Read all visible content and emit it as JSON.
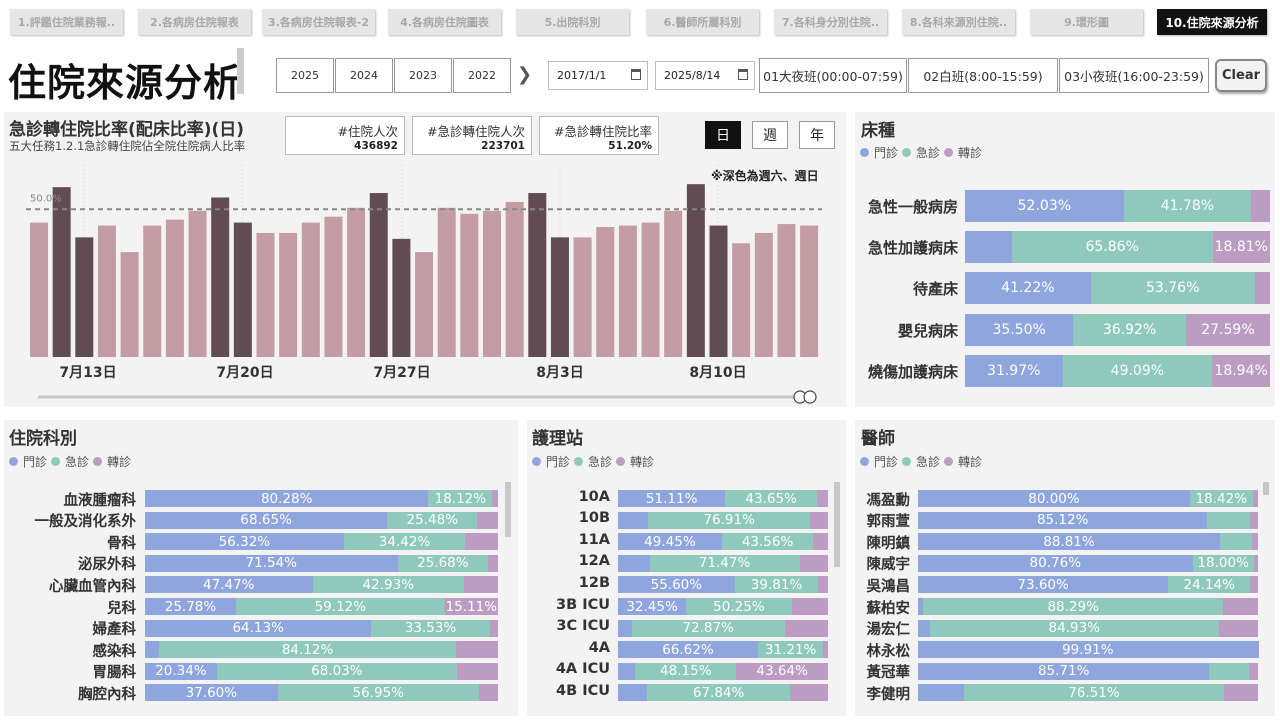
{
  "tabs": [
    {
      "label": "1.評鑑住院業務報.."
    },
    {
      "label": "2.各病房住院報表"
    },
    {
      "label": "3.各病房住院報表-2"
    },
    {
      "label": "4.各病房住院圖表"
    },
    {
      "label": "5.出院科別"
    },
    {
      "label": "6.醫師所屬科別"
    },
    {
      "label": "7.各科身分別住院.."
    },
    {
      "label": "8.各科來源別住院.."
    },
    {
      "label": "9.環形圖"
    },
    {
      "label": "10.住院來源分析"
    }
  ],
  "page_title": "住院來源分析",
  "years": [
    "2025",
    "2024",
    "2023",
    "2022"
  ],
  "date_from": "2017/1/1",
  "date_to": "2025/8/14",
  "shifts": [
    "01大夜班(00:00-07:59)",
    "02白班(8:00-15:59)",
    "03小夜班(16:00-23:59)"
  ],
  "clear_label": "Clear",
  "legend": {
    "outpatient": "門診",
    "emergency": "急診",
    "transfer": "轉診"
  },
  "colors": {
    "outpatient": "#8ea6dd",
    "emergency": "#8fc9bb",
    "transfer": "#bd9cc3",
    "bar_weekday": "#c49ca3",
    "bar_weekend": "#604c52"
  },
  "rate_panel": {
    "title": "急診轉住院比率(配床比率)(日)",
    "subtitle": "五大任務1.2.1急診轉住院佔全院住院病人比率",
    "kpis": [
      {
        "label": "#住院人次",
        "value": "436892"
      },
      {
        "label": "#急診轉住院人次",
        "value": "223701"
      },
      {
        "label": "#急診轉住院比率",
        "value": "51.20%"
      }
    ],
    "granularity": [
      "日",
      "週",
      "年"
    ],
    "note": "※深色為週六、週日",
    "ref_label": "50.0%"
  },
  "chart_data": {
    "type": "bar",
    "title": "急診轉住院比率(配床比率)(日)",
    "x_tick_labels": [
      "7月13日",
      "7月20日",
      "7月27日",
      "8月3日",
      "8月10日"
    ],
    "values": [
      45.5,
      57.5,
      40.5,
      44.5,
      35.5,
      44.5,
      46.5,
      49.5,
      54.0,
      45.5,
      42.0,
      42.0,
      45.5,
      47.5,
      50.5,
      55.5,
      40.0,
      35.5,
      50.5,
      48.5,
      49.5,
      52.5,
      55.5,
      40.5,
      40.5,
      44.0,
      44.5,
      45.5,
      49.5,
      58.5,
      44.5,
      38.5,
      42.0,
      45.0,
      44.5
    ],
    "weekend": [
      false,
      true,
      true,
      false,
      false,
      false,
      false,
      false,
      true,
      true,
      false,
      false,
      false,
      false,
      false,
      true,
      true,
      false,
      false,
      false,
      false,
      false,
      true,
      true,
      false,
      false,
      false,
      false,
      false,
      true,
      true,
      false,
      false,
      false,
      false
    ],
    "ref_line": 50.0,
    "ylim": [
      0,
      65
    ]
  },
  "bed_panel": {
    "title": "床種",
    "rows": [
      {
        "name": "急性一般病房",
        "o": 52.03,
        "e": 41.78,
        "t": 6.19,
        "lo": "52.03%",
        "le": "41.78%",
        "lt": ""
      },
      {
        "name": "急性加護病床",
        "o": 15.33,
        "e": 65.86,
        "t": 18.81,
        "lo": "",
        "le": "65.86%",
        "lt": "18.81%"
      },
      {
        "name": "待產床",
        "o": 41.22,
        "e": 53.76,
        "t": 5.02,
        "lo": "41.22%",
        "le": "53.76%",
        "lt": ""
      },
      {
        "name": "嬰兒病床",
        "o": 35.5,
        "e": 36.92,
        "t": 27.59,
        "lo": "35.50%",
        "le": "36.92%",
        "lt": "27.59%"
      },
      {
        "name": "燒傷加護病床",
        "o": 31.97,
        "e": 49.09,
        "t": 18.94,
        "lo": "31.97%",
        "le": "49.09%",
        "lt": "18.94%"
      }
    ]
  },
  "dept_panel": {
    "title": "住院科別",
    "rows": [
      {
        "name": "血液腫瘤科",
        "o": 80.28,
        "e": 18.12,
        "t": 1.6,
        "lo": "80.28%",
        "le": "18.12%",
        "lt": ""
      },
      {
        "name": "一般及消化系外",
        "o": 68.65,
        "e": 25.48,
        "t": 5.87,
        "lo": "68.65%",
        "le": "25.48%",
        "lt": ""
      },
      {
        "name": "骨科",
        "o": 56.32,
        "e": 34.42,
        "t": 9.26,
        "lo": "56.32%",
        "le": "34.42%",
        "lt": ""
      },
      {
        "name": "泌尿外科",
        "o": 71.54,
        "e": 25.68,
        "t": 2.78,
        "lo": "71.54%",
        "le": "25.68%",
        "lt": ""
      },
      {
        "name": "心臟血管內科",
        "o": 47.47,
        "e": 42.93,
        "t": 9.6,
        "lo": "47.47%",
        "le": "42.93%",
        "lt": ""
      },
      {
        "name": "兒科",
        "o": 25.78,
        "e": 59.12,
        "t": 15.11,
        "lo": "25.78%",
        "le": "59.12%",
        "lt": "15.11%"
      },
      {
        "name": "婦產科",
        "o": 64.13,
        "e": 33.53,
        "t": 2.34,
        "lo": "64.13%",
        "le": "33.53%",
        "lt": ""
      },
      {
        "name": "感染科",
        "o": 4.0,
        "e": 84.12,
        "t": 11.88,
        "lo": "",
        "le": "84.12%",
        "lt": ""
      },
      {
        "name": "胃腸科",
        "o": 20.34,
        "e": 68.03,
        "t": 11.63,
        "lo": "20.34%",
        "le": "68.03%",
        "lt": ""
      },
      {
        "name": "胸腔內科",
        "o": 37.6,
        "e": 56.95,
        "t": 5.45,
        "lo": "37.60%",
        "le": "56.95%",
        "lt": ""
      }
    ]
  },
  "station_panel": {
    "title": "護理站",
    "rows": [
      {
        "name": "10A",
        "o": 51.11,
        "e": 43.65,
        "t": 5.24,
        "lo": "51.11%",
        "le": "43.65%",
        "lt": ""
      },
      {
        "name": "10B",
        "o": 14.5,
        "e": 76.91,
        "t": 8.59,
        "lo": "",
        "le": "76.91%",
        "lt": ""
      },
      {
        "name": "11A",
        "o": 49.45,
        "e": 43.56,
        "t": 6.99,
        "lo": "49.45%",
        "le": "43.56%",
        "lt": ""
      },
      {
        "name": "12A",
        "o": 15.0,
        "e": 71.47,
        "t": 13.53,
        "lo": "",
        "le": "71.47%",
        "lt": ""
      },
      {
        "name": "12B",
        "o": 55.6,
        "e": 39.81,
        "t": 4.59,
        "lo": "55.60%",
        "le": "39.81%",
        "lt": ""
      },
      {
        "name": "3B ICU",
        "o": 32.45,
        "e": 50.25,
        "t": 17.3,
        "lo": "32.45%",
        "le": "50.25%",
        "lt": ""
      },
      {
        "name": "3C ICU",
        "o": 6.5,
        "e": 72.87,
        "t": 20.63,
        "lo": "",
        "le": "72.87%",
        "lt": ""
      },
      {
        "name": "4A",
        "o": 66.62,
        "e": 31.21,
        "t": 2.17,
        "lo": "66.62%",
        "le": "31.21%",
        "lt": ""
      },
      {
        "name": "4A ICU",
        "o": 8.21,
        "e": 48.15,
        "t": 43.64,
        "lo": "",
        "le": "48.15%",
        "lt": "43.64%"
      },
      {
        "name": "4B ICU",
        "o": 14.0,
        "e": 67.84,
        "t": 18.16,
        "lo": "",
        "le": "67.84%",
        "lt": ""
      }
    ]
  },
  "doctor_panel": {
    "title": "醫師",
    "rows": [
      {
        "name": "馮盈勳",
        "o": 80.0,
        "e": 18.42,
        "t": 1.58,
        "lo": "80.00%",
        "le": "18.42%",
        "lt": ""
      },
      {
        "name": "郭雨萱",
        "o": 85.12,
        "e": 12.5,
        "t": 2.38,
        "lo": "85.12%",
        "le": "",
        "lt": ""
      },
      {
        "name": "陳明鎮",
        "o": 88.81,
        "e": 9.5,
        "t": 1.69,
        "lo": "88.81%",
        "le": "",
        "lt": ""
      },
      {
        "name": "陳威宇",
        "o": 80.76,
        "e": 18.0,
        "t": 1.24,
        "lo": "80.76%",
        "le": "18.00%",
        "lt": ""
      },
      {
        "name": "吳鴻昌",
        "o": 73.6,
        "e": 24.14,
        "t": 2.26,
        "lo": "73.60%",
        "le": "24.14%",
        "lt": ""
      },
      {
        "name": "蘇柏安",
        "o": 1.5,
        "e": 88.29,
        "t": 10.21,
        "lo": "",
        "le": "88.29%",
        "lt": ""
      },
      {
        "name": "湯宏仁",
        "o": 3.5,
        "e": 84.93,
        "t": 11.57,
        "lo": "",
        "le": "84.93%",
        "lt": ""
      },
      {
        "name": "林永松",
        "o": 99.91,
        "e": 0.05,
        "t": 0.04,
        "lo": "99.91%",
        "le": "",
        "lt": ""
      },
      {
        "name": "黃冠華",
        "o": 85.71,
        "e": 11.5,
        "t": 2.79,
        "lo": "85.71%",
        "le": "",
        "lt": ""
      },
      {
        "name": "李健明",
        "o": 13.5,
        "e": 76.51,
        "t": 9.99,
        "lo": "",
        "le": "76.51%",
        "lt": ""
      }
    ]
  }
}
